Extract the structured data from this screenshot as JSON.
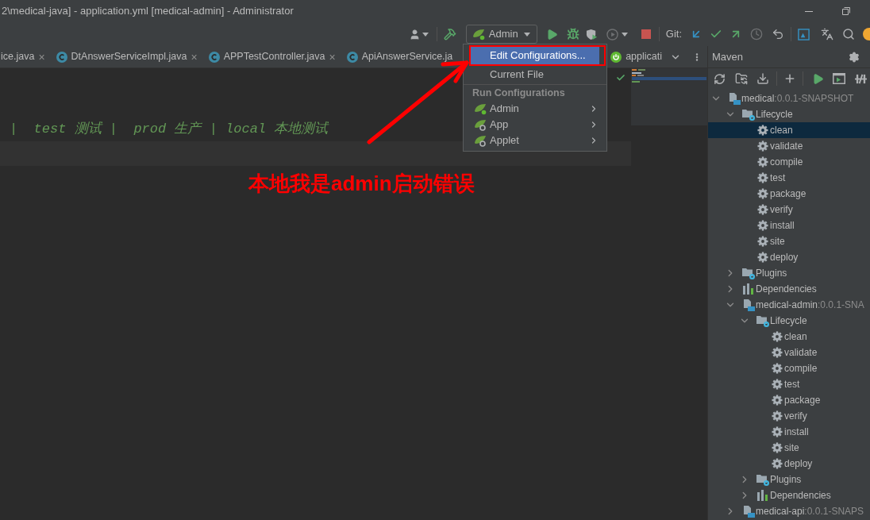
{
  "window": {
    "title": "2\\medical-java] - application.yml [medical-admin] - Administrator"
  },
  "toolbar": {
    "run_configuration": {
      "label": "Admin",
      "running": true
    },
    "vcs_label": "Git:"
  },
  "tabs": [
    {
      "kind": "plain",
      "label": "ice.java",
      "close": "×",
      "selected": false
    },
    {
      "kind": "class",
      "label": "DtAnswerServiceImpl.java",
      "close": "×",
      "selected": false
    },
    {
      "kind": "class",
      "label": "APPTestController.java",
      "close": "×",
      "selected": false
    },
    {
      "kind": "class",
      "label": "ApiAnswerService.ja",
      "selected": false
    },
    {
      "kind": "spring",
      "label": "applicati",
      "selected": false
    }
  ],
  "run_menu": {
    "items": [
      {
        "kind": "action",
        "label": "Edit Configurations...",
        "selected": true
      },
      {
        "kind": "action",
        "label": "Current File",
        "selected": false
      },
      {
        "kind": "header",
        "label": "Run Configurations"
      },
      {
        "kind": "config",
        "label": "Admin",
        "running": true,
        "selected": false
      },
      {
        "kind": "config",
        "label": "App",
        "running": false,
        "selected": false
      },
      {
        "kind": "config",
        "label": "Applet",
        "running": false,
        "selected": false
      }
    ]
  },
  "editor": {
    "lines": [
      {
        "text": "|  test 测试 |  prod 生产 | local 本地测试"
      }
    ]
  },
  "annotation": {
    "text": "本地我是admin启动错误"
  },
  "maven": {
    "title": "Maven",
    "tree": [
      {
        "kind": "project",
        "name": "medical",
        "version": ":0.0.1-SNAPSHOT",
        "expanded": true,
        "selected": false,
        "children": [
          {
            "kind": "lifecycle",
            "label": "Lifecycle",
            "expanded": true,
            "selected": false,
            "children": [
              {
                "kind": "goal",
                "label": "clean",
                "selected": true
              },
              {
                "kind": "goal",
                "label": "validate",
                "selected": false
              },
              {
                "kind": "goal",
                "label": "compile",
                "selected": false
              },
              {
                "kind": "goal",
                "label": "test",
                "selected": false
              },
              {
                "kind": "goal",
                "label": "package",
                "selected": false
              },
              {
                "kind": "goal",
                "label": "verify",
                "selected": false
              },
              {
                "kind": "goal",
                "label": "install",
                "selected": false
              },
              {
                "kind": "goal",
                "label": "site",
                "selected": false
              },
              {
                "kind": "goal",
                "label": "deploy",
                "selected": false
              }
            ]
          },
          {
            "kind": "plugins",
            "label": "Plugins",
            "expanded": false,
            "selected": false
          },
          {
            "kind": "dependencies",
            "label": "Dependencies",
            "expanded": false,
            "selected": false
          },
          {
            "kind": "project",
            "name": "medical-admin",
            "version": ":0.0.1-SNA",
            "expanded": true,
            "selected": false,
            "children": [
              {
                "kind": "lifecycle",
                "label": "Lifecycle",
                "expanded": true,
                "selected": false,
                "children": [
                  {
                    "kind": "goal",
                    "label": "clean",
                    "selected": false
                  },
                  {
                    "kind": "goal",
                    "label": "validate",
                    "selected": false
                  },
                  {
                    "kind": "goal",
                    "label": "compile",
                    "selected": false
                  },
                  {
                    "kind": "goal",
                    "label": "test",
                    "selected": false
                  },
                  {
                    "kind": "goal",
                    "label": "package",
                    "selected": false
                  },
                  {
                    "kind": "goal",
                    "label": "verify",
                    "selected": false
                  },
                  {
                    "kind": "goal",
                    "label": "install",
                    "selected": false
                  },
                  {
                    "kind": "goal",
                    "label": "site",
                    "selected": false
                  },
                  {
                    "kind": "goal",
                    "label": "deploy",
                    "selected": false
                  }
                ]
              },
              {
                "kind": "plugins",
                "label": "Plugins",
                "expanded": false,
                "selected": false
              },
              {
                "kind": "dependencies",
                "label": "Dependencies",
                "expanded": false,
                "selected": false
              }
            ]
          },
          {
            "kind": "project",
            "name": "medical-api",
            "version": ":0.0.1-SNAPS",
            "expanded": false,
            "selected": false
          }
        ]
      }
    ]
  }
}
